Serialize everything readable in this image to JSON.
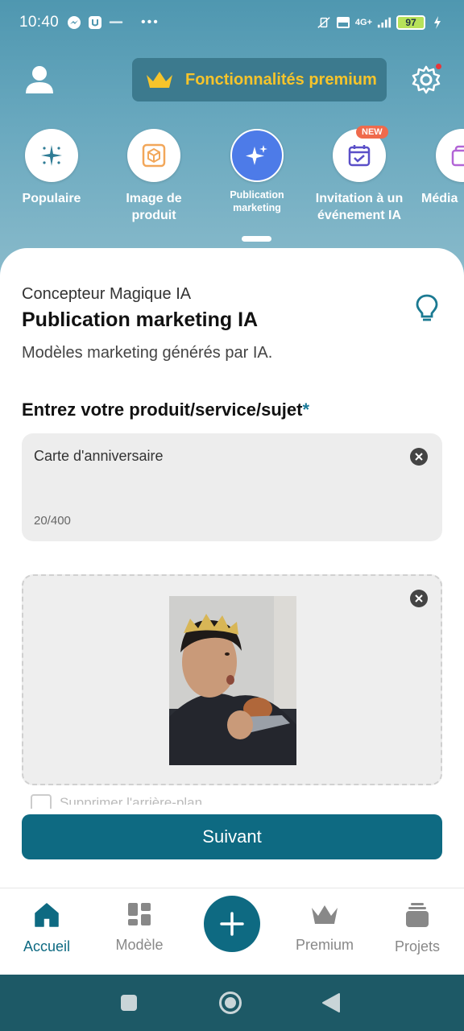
{
  "status_bar": {
    "time": "10:40",
    "battery": "97",
    "network": "4G+"
  },
  "header": {
    "premium_label": "Fonctionnalités premium"
  },
  "categories": [
    {
      "label": "Populaire",
      "icon": "sparkle-icon"
    },
    {
      "label": "Image de produit",
      "icon": "product-box-icon"
    },
    {
      "label": "Publication marketing",
      "icon": "magic-sparkles-icon",
      "active": true
    },
    {
      "label": "Invitation à un événement IA",
      "icon": "calendar-check-icon",
      "badge": "NEW"
    },
    {
      "label": "Média",
      "icon": "image-gallery-icon"
    }
  ],
  "card": {
    "overline": "Concepteur Magique IA",
    "title": "Publication marketing IA",
    "description": "Modèles marketing générés par IA.",
    "field_label": "Entrez votre produit/service/sujet",
    "required_mark": "*",
    "input_value": "Carte d'anniversaire",
    "input_count": "20/400",
    "checkbox_label": "Supprimer l'arrière-plan",
    "next_button": "Suivant"
  },
  "bottom_nav": [
    {
      "label": "Accueil",
      "icon": "home-icon",
      "active": true
    },
    {
      "label": "Modèle",
      "icon": "template-grid-icon"
    },
    {
      "label": "",
      "icon": "plus-icon"
    },
    {
      "label": "Premium",
      "icon": "crown-icon"
    },
    {
      "label": "Projets",
      "icon": "projects-stack-icon"
    }
  ],
  "colors": {
    "accent": "#0e6a82",
    "premium_gold": "#f6c42b",
    "active_category": "#4d7be8",
    "new_badge": "#ef6a4c"
  }
}
